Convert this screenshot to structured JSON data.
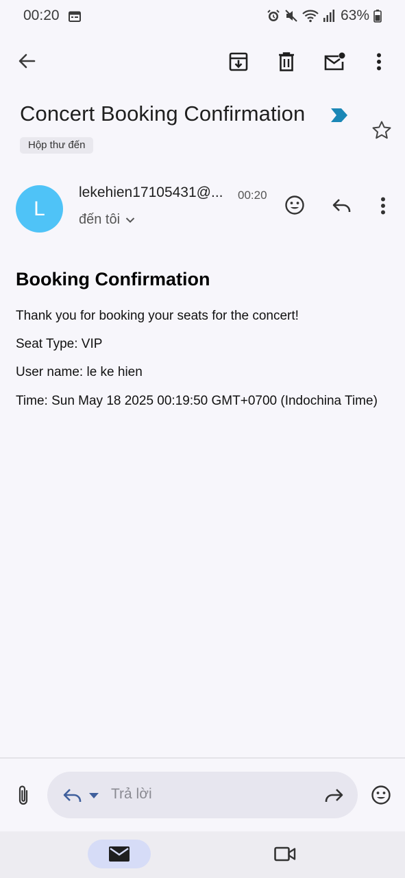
{
  "status_bar": {
    "time": "00:20",
    "battery": "63%",
    "icons": [
      "calendar-icon",
      "alarm-icon",
      "mute-icon",
      "wifi-icon",
      "signal-icon",
      "battery-icon"
    ]
  },
  "toolbar": {
    "icons": [
      "back-arrow-icon",
      "archive-icon",
      "delete-icon",
      "mark-unread-icon",
      "more-vertical-icon"
    ]
  },
  "email": {
    "subject": "Concert Booking Confirmation",
    "label": "Hộp thư đến",
    "sender": "lekehien17105431@...",
    "avatar_letter": "L",
    "avatar_color": "#4fc3f7",
    "time": "00:20",
    "recipient": "đến tôi",
    "body": {
      "title": "Booking Confirmation",
      "lines": [
        "Thank you for booking your seats for the concert!",
        "Seat Type: VIP",
        "User name: le ke hien",
        "Time: Sun May 18 2025 00:19:50 GMT+0700 (Indochina Time)"
      ]
    }
  },
  "reply_bar": {
    "placeholder": "Trả lời"
  },
  "colors": {
    "background": "#f7f6fb",
    "importance_marker": "#1b87b6",
    "nav_active": "#d6dcf7"
  }
}
